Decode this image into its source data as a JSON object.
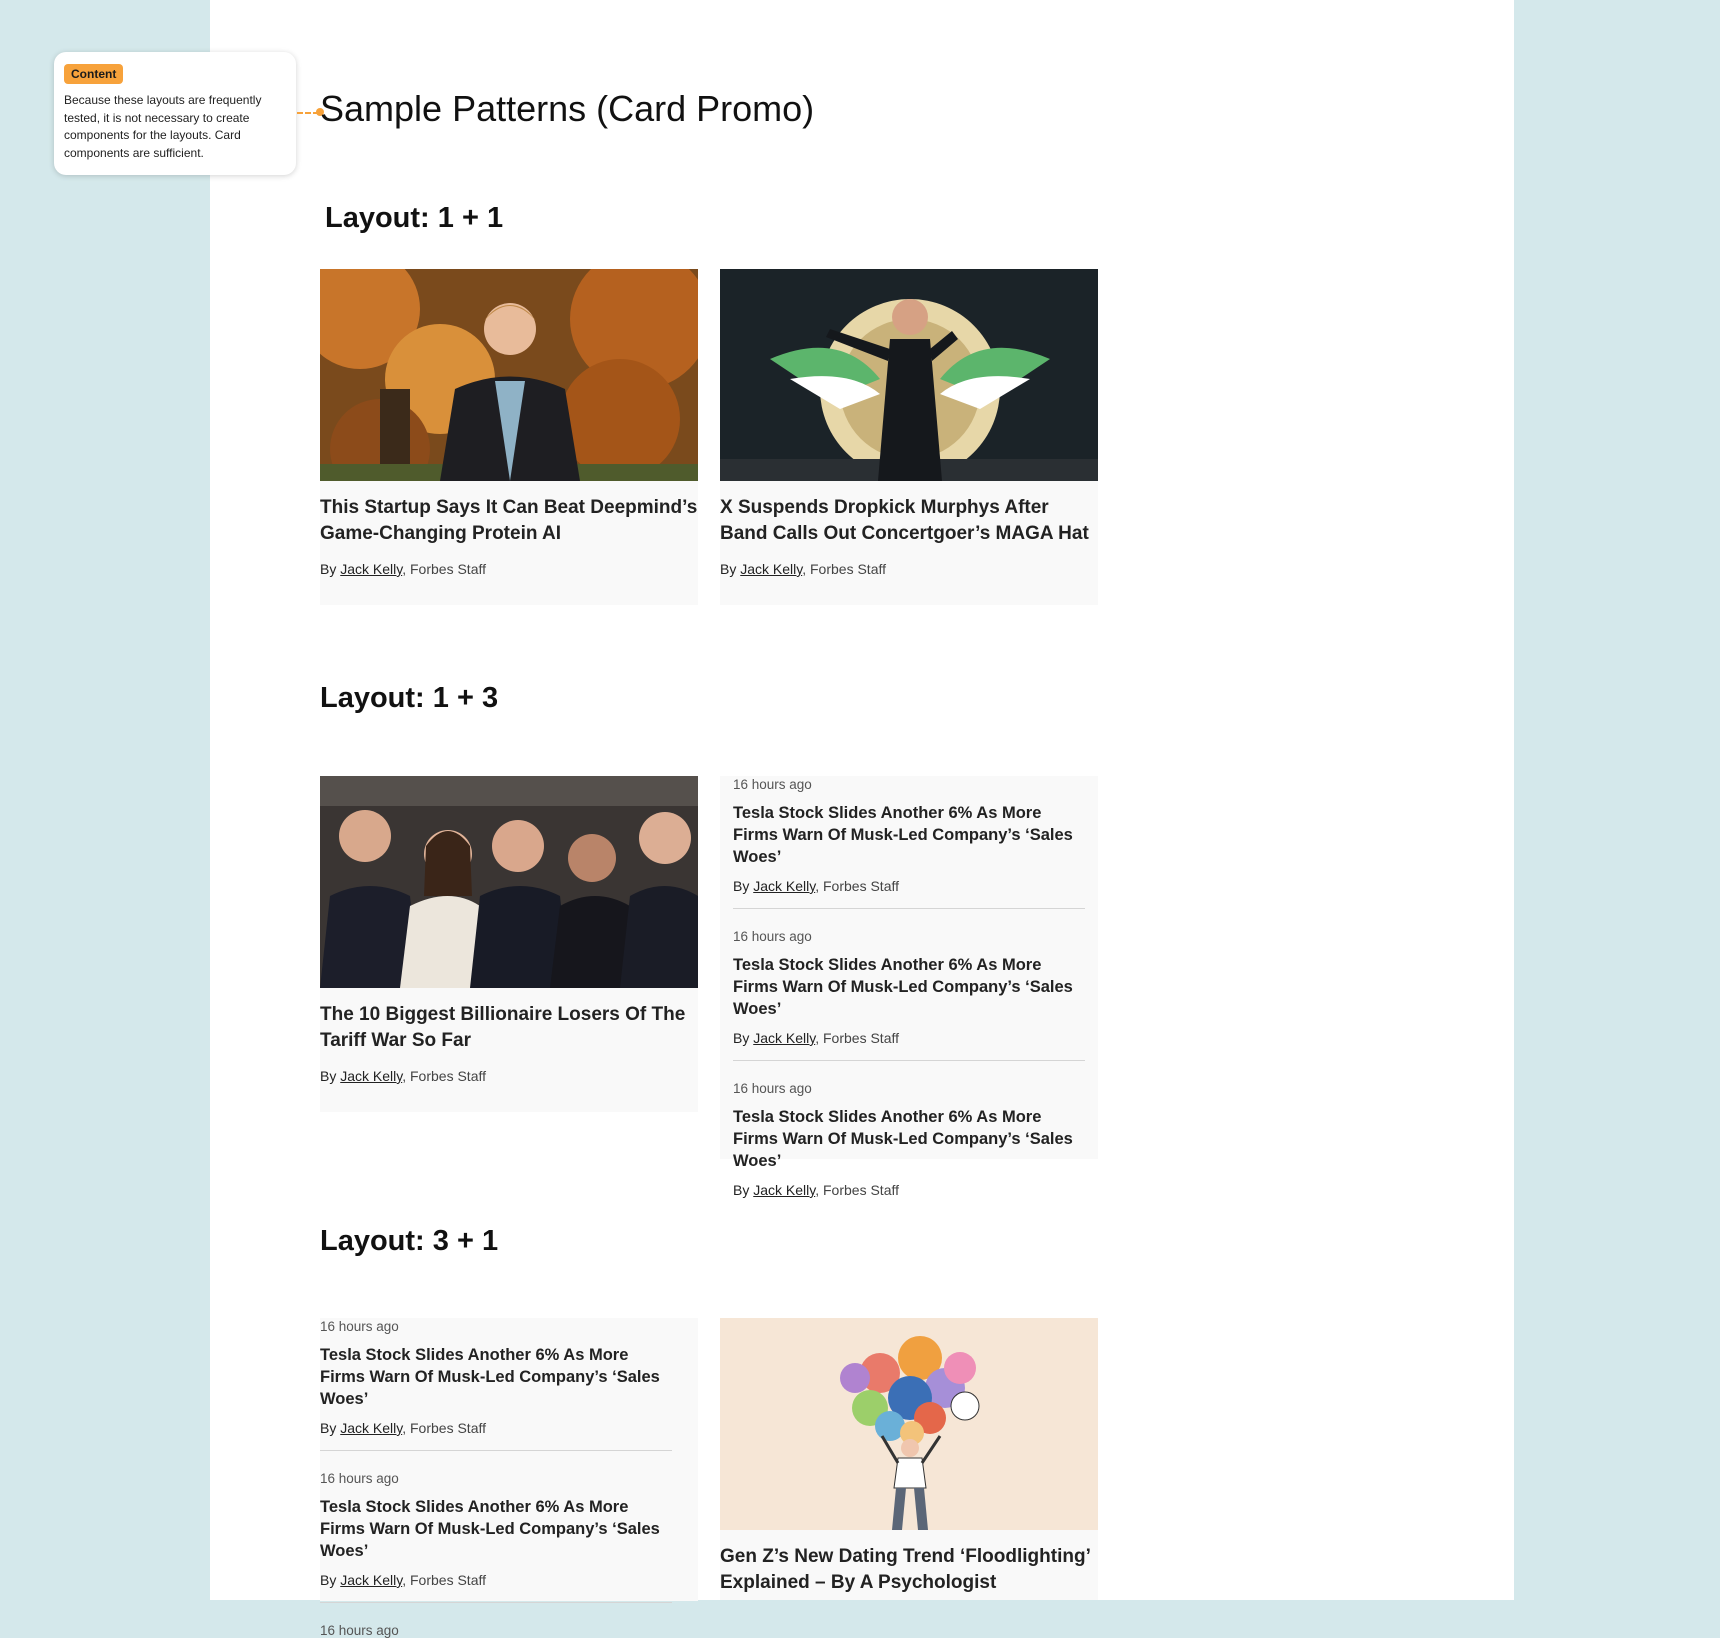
{
  "note": {
    "tag": "Content",
    "text": "Because these layouts are frequently tested, it is not necessary to create components for the layouts. Card components are sufficient."
  },
  "page_title": "Sample Patterns (Card Promo)",
  "byline": {
    "by": "By",
    "author": "Jack Kelly",
    "staff": ", Forbes Staff"
  },
  "sections": {
    "s1": {
      "title": "Layout: 1 + 1",
      "cards": [
        {
          "headline": "This Startup Says It Can Beat Deepmind’s Game-Changing Protein AI",
          "image": "man-autumn-tree-photo"
        },
        {
          "headline": "X Suspends Dropkick Murphys After Band Calls Out Concertgoer’s MAGA Hat",
          "image": "singer-on-stage-photo"
        }
      ]
    },
    "s2": {
      "title": "Layout: 1 + 3",
      "card": {
        "headline": "The 10 Biggest Billionaire Losers Of The Tariff War So Far",
        "image": "billionaires-group-photo"
      },
      "items": [
        {
          "time": "16 hours ago",
          "headline": "Tesla Stock Slides Another 6% As More Firms Warn Of Musk-Led Company’s ‘Sales Woes’"
        },
        {
          "time": "16 hours ago",
          "headline": "Tesla Stock Slides Another 6% As More Firms Warn Of Musk-Led Company’s ‘Sales Woes’"
        },
        {
          "time": "16 hours ago",
          "headline": "Tesla Stock Slides Another 6% As More Firms Warn Of Musk-Led Company’s ‘Sales Woes’"
        }
      ]
    },
    "s3": {
      "title": "Layout: 3 + 1",
      "items": [
        {
          "time": "16 hours ago",
          "headline": "Tesla Stock Slides Another 6% As More Firms Warn Of Musk-Led Company’s ‘Sales Woes’"
        },
        {
          "time": "16 hours ago",
          "headline": "Tesla Stock Slides Another 6% As More Firms Warn Of Musk-Led Company’s ‘Sales Woes’"
        },
        {
          "time": "16 hours ago"
        }
      ],
      "card": {
        "headline": "Gen Z’s New Dating Trend ‘Floodlighting’ Explained – By A Psychologist",
        "image": "balloons-illustration"
      }
    }
  },
  "colors": {
    "background": "#d4e8eb",
    "accent": "#f7a23b",
    "card_bg": "#f9f9f9",
    "illustration_bg": "#f6e6d6"
  }
}
